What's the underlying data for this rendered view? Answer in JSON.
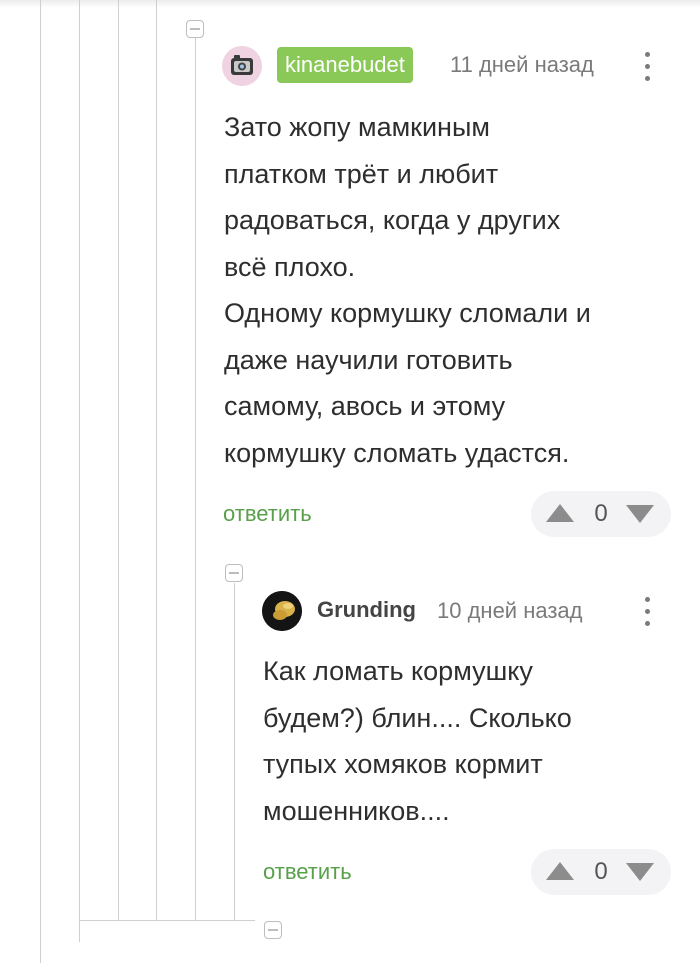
{
  "comments": [
    {
      "username": "kinanebudet",
      "timestamp": "11 дней назад",
      "avatar_icon": "camera-avatar-icon",
      "text": "Зато жопу мамкиным\nплатком трёт и любит\nрадоваться, когда у других\nвсё плохо.\nОдному кормушку сломали и\nдаже научили готовить\nсамому, авось и этому\nкормушку сломать удастся.",
      "reply_label": "ответить",
      "rating": "0",
      "badge_color": "#8ac858"
    },
    {
      "username": "Grunding",
      "timestamp": "10 дней назад",
      "avatar_icon": "hand-avatar-icon",
      "text": "Как ломать кормушку\nбудем?) блин.... Сколько\nтупых хомяков кормит\nмошенников....",
      "reply_label": "ответить",
      "rating": "0"
    }
  ],
  "colors": {
    "reply_link": "#59a04a",
    "thread_line": "#cfcfcf",
    "vote_background": "#f3f3f5"
  }
}
